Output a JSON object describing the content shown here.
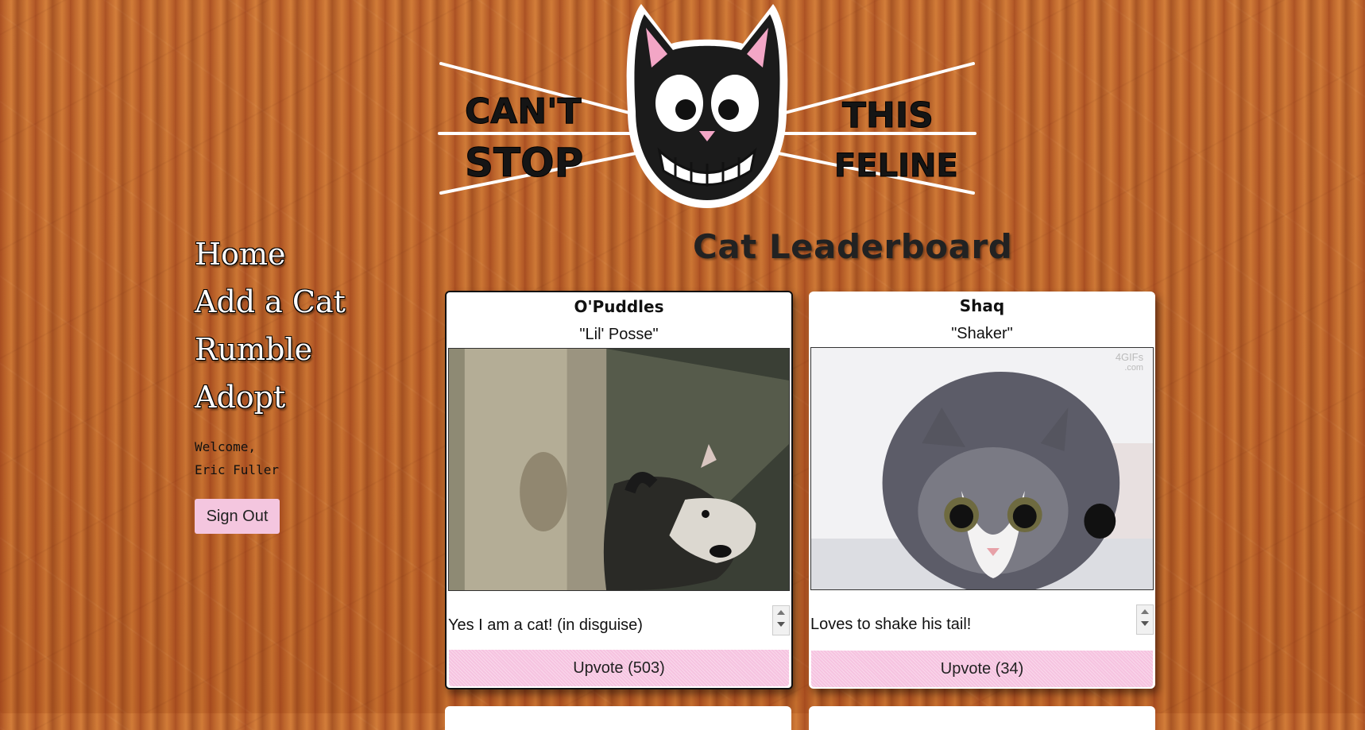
{
  "logo": {
    "left_words": [
      "CAN'T",
      "STOP"
    ],
    "right_words": [
      "THIS",
      "FELINE"
    ]
  },
  "nav": {
    "items": [
      "Home",
      "Add a Cat",
      "Rumble",
      "Adopt"
    ]
  },
  "user": {
    "welcome": "Welcome,",
    "name": "Eric Fuller",
    "sign_out": "Sign Out"
  },
  "page": {
    "title": "Cat Leaderboard"
  },
  "cards": [
    {
      "name": "O'Puddles",
      "nickname": "\"Lil' Posse\"",
      "image": "opossum-photo",
      "description": "Yes I am a cat! (in disguise)",
      "upvote": "Upvote (503)"
    },
    {
      "name": "Shaq",
      "nickname": "\"Shaker\"",
      "image": "tabby-cat-photo",
      "watermark_1": "4GIFs",
      "watermark_2": ".com",
      "description": "Loves to shake his tail!",
      "upvote": "Upvote (34)"
    }
  ],
  "colors": {
    "background": "#c8702e",
    "button_pink": "#f4c6df",
    "card": "#ffffff"
  }
}
